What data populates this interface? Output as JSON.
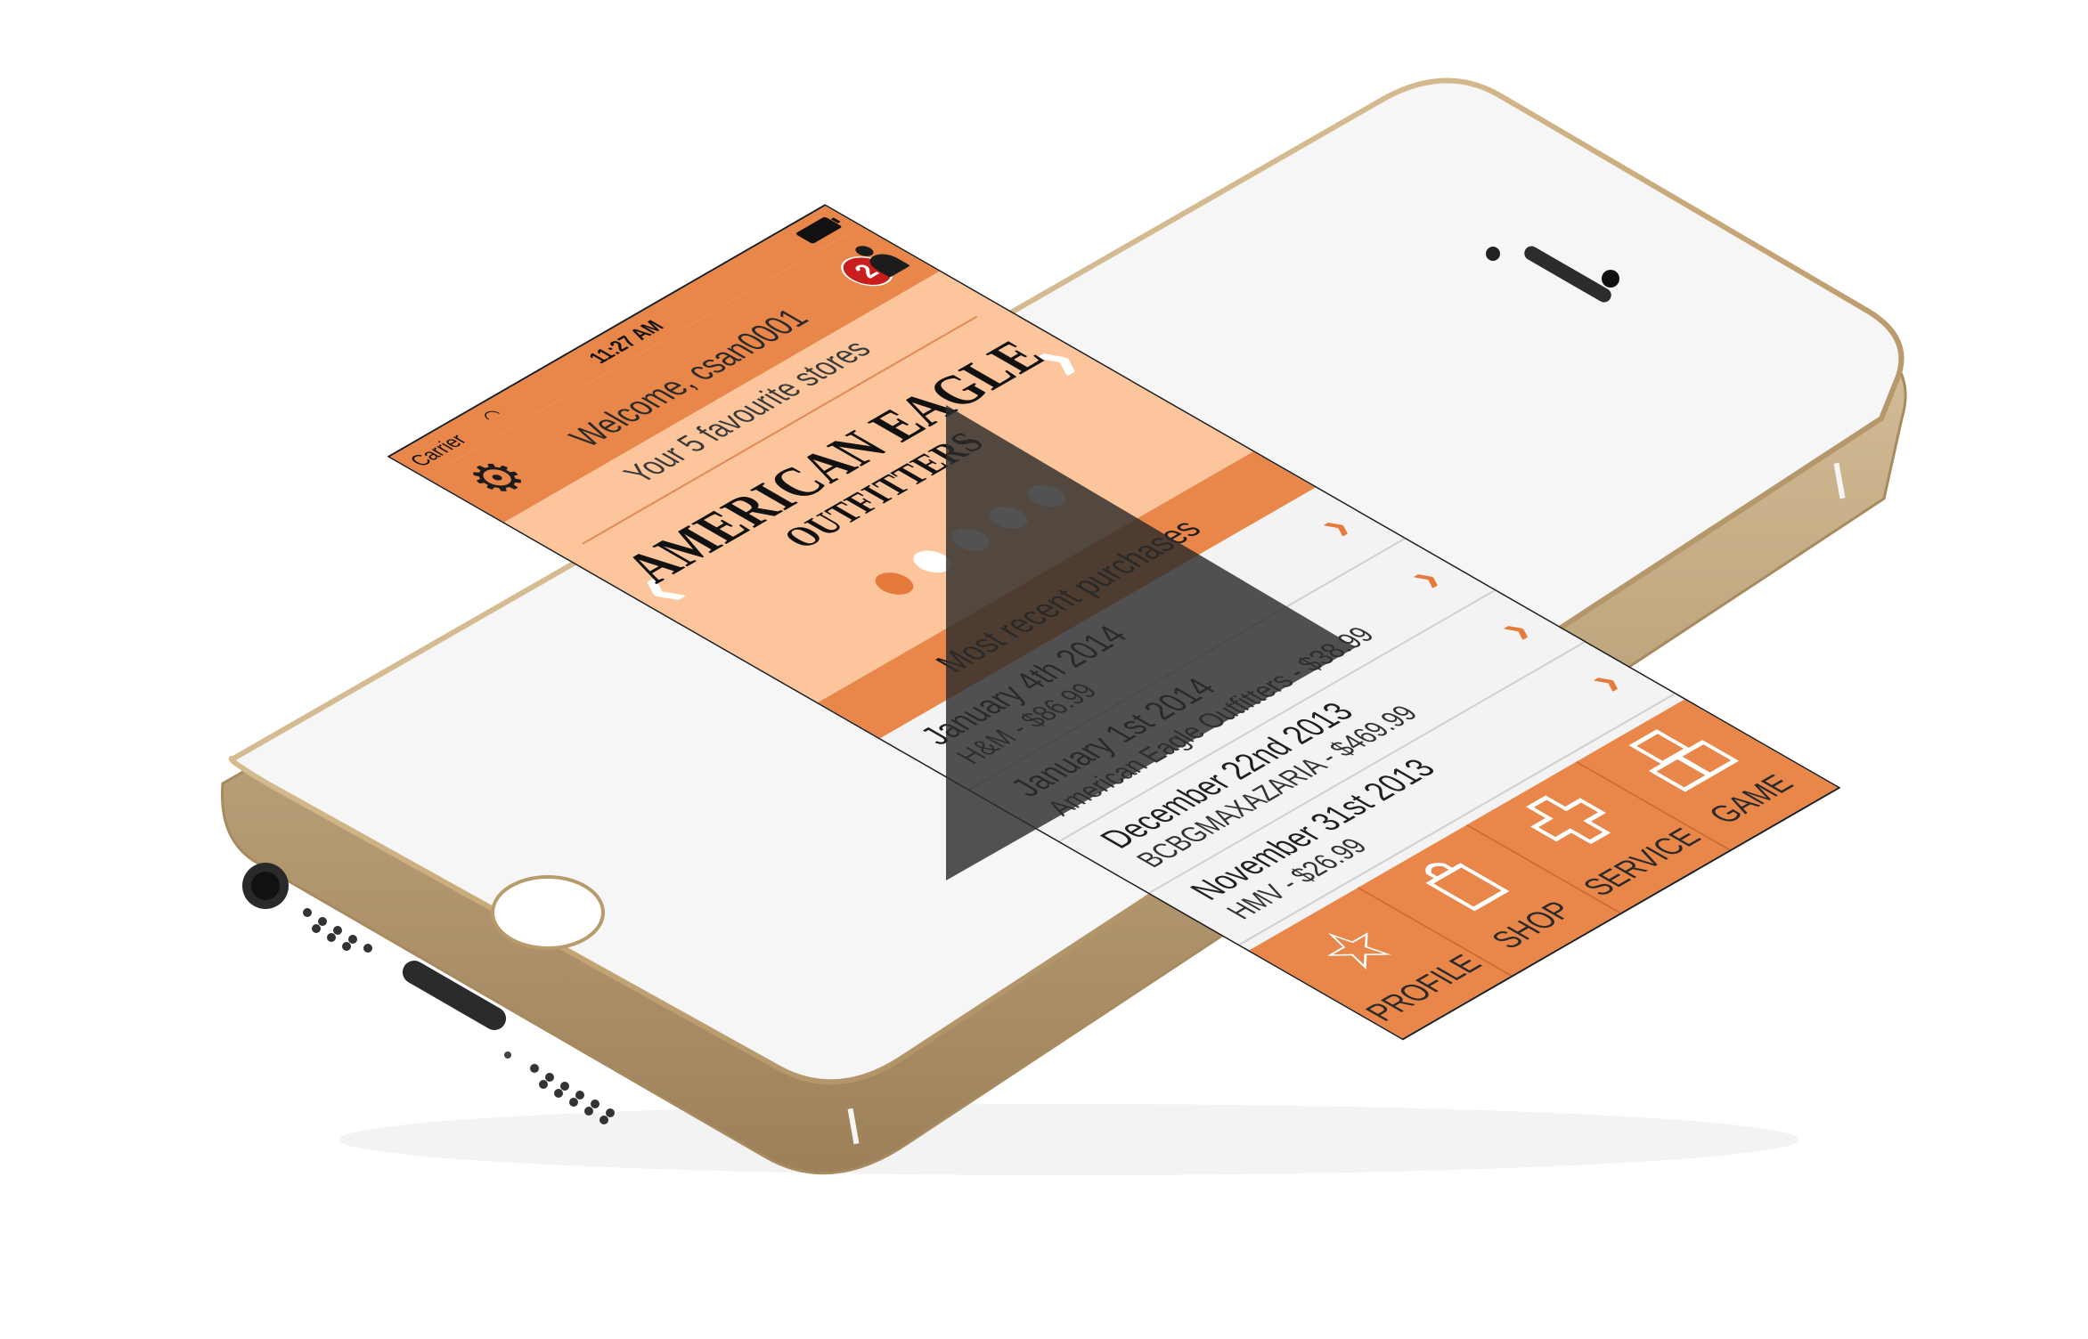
{
  "status_bar": {
    "carrier": "Carrier",
    "time": "11:27 AM",
    "wifi_icon": "wifi-icon",
    "battery_icon": "battery-icon"
  },
  "header": {
    "welcome": "Welcome, csan0001",
    "settings_icon": "gear-icon",
    "notification_count": "2"
  },
  "favourites": {
    "subtitle": "Your 5 favourite stores",
    "brand_line1": "AMERICAN EAGLE",
    "brand_line2": "OUTFITTERS",
    "prev": "‹",
    "next": "›",
    "page_count": 5,
    "active_page": 1
  },
  "recent": {
    "heading": "Most recent purchases",
    "items": [
      {
        "date": "January 4th 2014",
        "detail": "H&M - $86.99"
      },
      {
        "date": "January 1st 2014",
        "detail": "American Eagle Outfitters  - $38.99"
      },
      {
        "date": "December 22nd 2013",
        "detail": "BCBGMAXAZARIA - $469.99"
      },
      {
        "date": "November 31st 2013",
        "detail": "HMV - $26.99"
      }
    ]
  },
  "tabs": [
    {
      "label": "PROFILE",
      "icon": "star-icon"
    },
    {
      "label": "SHOP",
      "icon": "shopping-bag-icon"
    },
    {
      "label": "SERVICE",
      "icon": "plus-icon"
    },
    {
      "label": "GAME",
      "icon": "blocks-icon"
    }
  ],
  "colors": {
    "accent": "#e9874a",
    "accent_light": "#fdc59b",
    "badge": "#c81e1e",
    "phone_body": "#c9b08a"
  },
  "video_overlay_icon": "play-icon"
}
